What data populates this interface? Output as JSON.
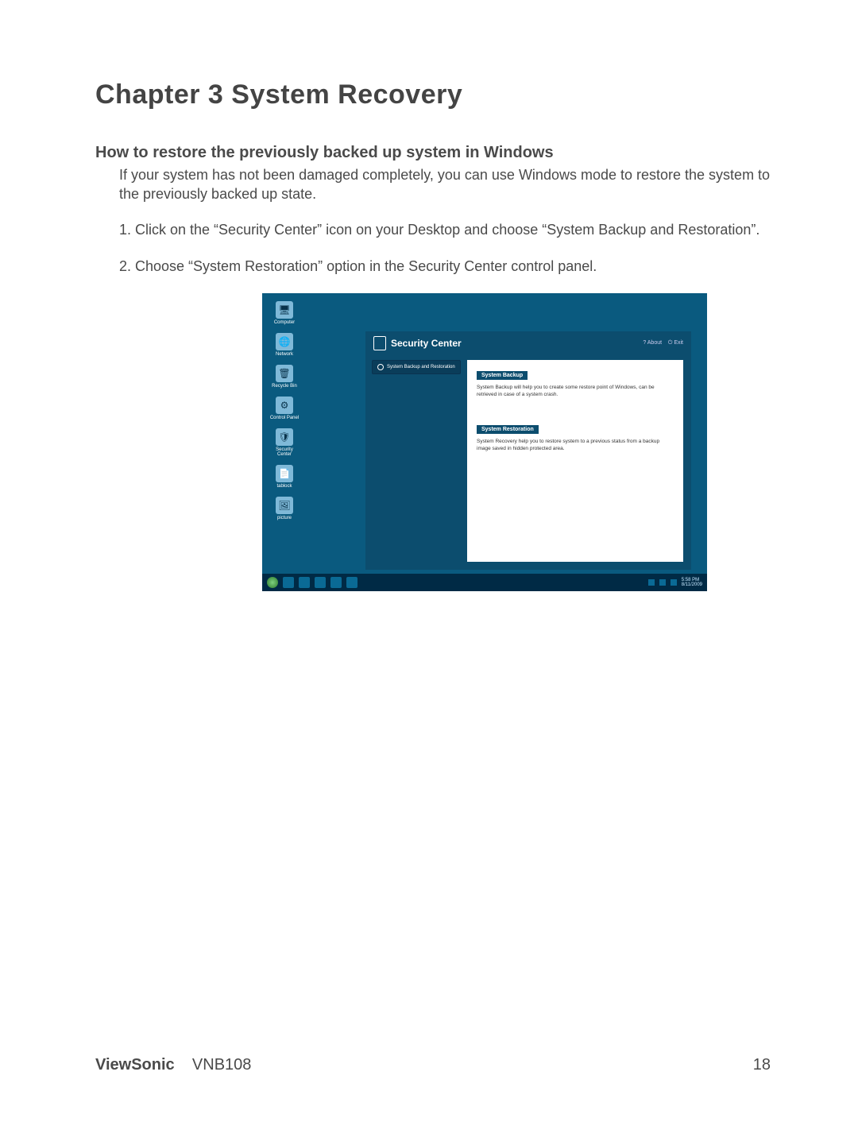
{
  "heading": "Chapter 3 System Recovery",
  "subheading": "How to restore the previously backed up system in Windows",
  "intro": "If your system has not been damaged completely, you can use Windows mode to restore the system to the previously backed up state.",
  "steps": {
    "s1": "1. Click on the “Security Center” icon on your Desktop and choose “System Backup and Restoration”.",
    "s2": "2. Choose “System Restoration” option in the Security Center control panel."
  },
  "shot": {
    "desktop": {
      "i0": "Computer",
      "i1": "Network",
      "i2": "Recycle Bin",
      "i3": "Control Panel",
      "i4": "Security Center",
      "i5": "tablock",
      "i6": "picture"
    },
    "panel": {
      "title": "Security Center",
      "about": "About",
      "exit": "Exit",
      "sidebar": "System Backup and Restoration",
      "opt1_title": "System Backup",
      "opt1_text": "System Backup will help you to create some restore point of Windows, can be retrieved in case of a system crash.",
      "opt2_title": "System Restoration",
      "opt2_text": "System Recovery help you to restore system to a previous status from a backup image saved in hidden protected area."
    },
    "taskbar": {
      "time": "5:58 PM",
      "date": "8/11/2009"
    }
  },
  "footer": {
    "brand": "ViewSonic",
    "model": "VNB108",
    "page": "18"
  }
}
